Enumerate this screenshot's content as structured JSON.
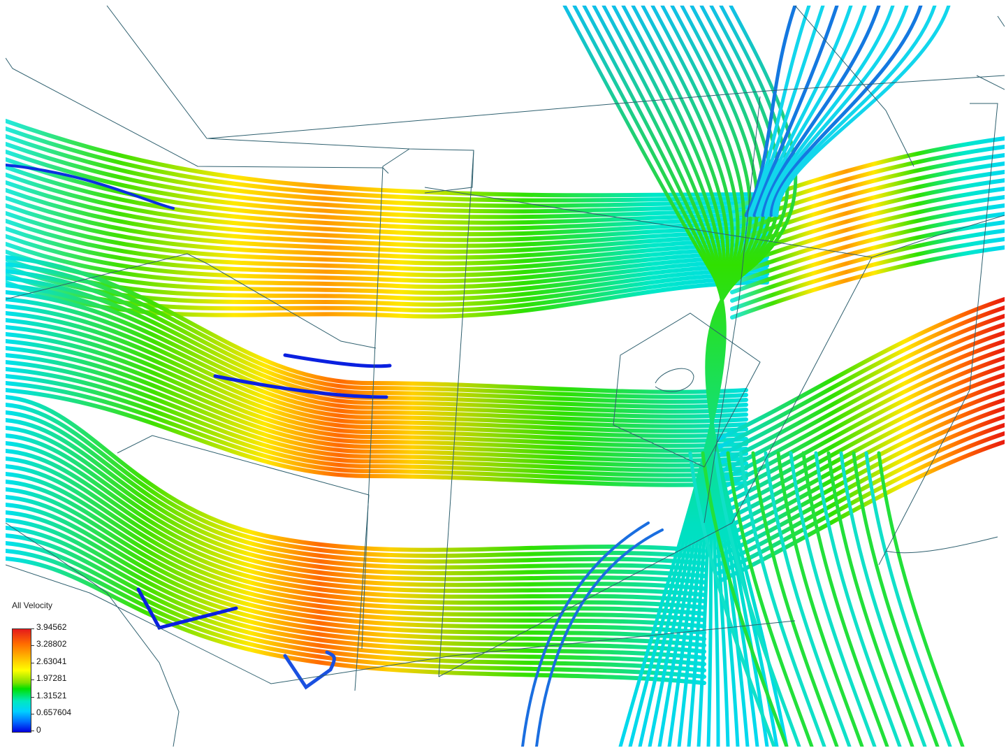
{
  "legend": {
    "title": "All Velocity",
    "ticks": [
      "3.94562",
      "3.28802",
      "2.63041",
      "1.97281",
      "1.31521",
      "0.657604",
      "0"
    ]
  },
  "colors": {
    "red": "#e8190e",
    "orange": "#ff7a00",
    "yellow": "#ffee00",
    "green": "#22dd00",
    "cyan": "#00e5e5",
    "blue": "#1060e8",
    "darkblue": "#0000dd",
    "edge": "#2e5f6e"
  }
}
